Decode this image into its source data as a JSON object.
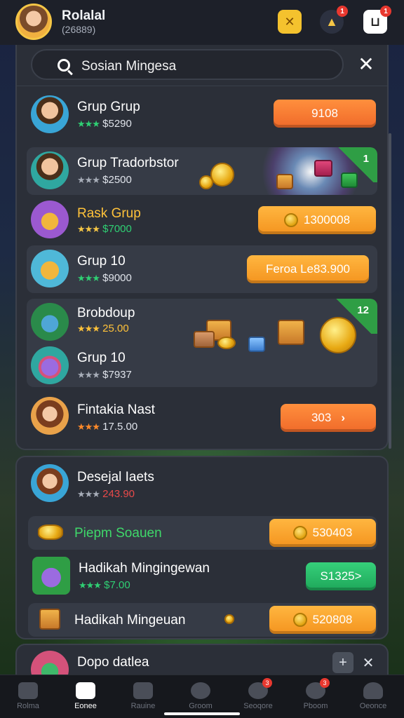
{
  "header": {
    "username": "Rolalal",
    "user_id": "(26889)",
    "badge_gift": "1",
    "badge_mail": "1"
  },
  "search": {
    "value": "Sosian Mingesa"
  },
  "list": [
    {
      "name": "Grup Grup",
      "stars": "★★★",
      "amount": "$5290",
      "button": "9108"
    },
    {
      "name": "Grup Tradorbstor",
      "stars": "★★★",
      "amount": "$2500",
      "tag": "1"
    },
    {
      "name": "Rask Grup",
      "stars": "★★★",
      "amount": "$7000",
      "button": "1300008"
    },
    {
      "name": "Grup 10",
      "stars": "★★★",
      "amount": "$9000",
      "button": "Feroa Le83.900"
    },
    {
      "name": "Brobdoup",
      "stars": "★★★",
      "amount": "25.00",
      "tag": "12"
    },
    {
      "name": "Grup 10",
      "stars": "★★★",
      "amount": "$7937"
    },
    {
      "name": "Fintakia Nast",
      "stars": "★★★",
      "amount": "17.5.00",
      "button": "303"
    }
  ],
  "section2": {
    "title": "Desejal Iaets",
    "stars": "★★★",
    "amount": "243.90",
    "rows": [
      {
        "name": "Piepm Soauen",
        "button": "530403"
      },
      {
        "name": "Hadikah Mingingewan",
        "stars": "★★★",
        "amount": "$7.00",
        "button": "S1325>"
      },
      {
        "name": "Hadikah Mingeuan",
        "button": "520808"
      }
    ]
  },
  "section3": {
    "title": "Dopo datlea"
  },
  "nav": [
    {
      "label": "Rolma"
    },
    {
      "label": "Eonee"
    },
    {
      "label": "Rauine"
    },
    {
      "label": "Groom"
    },
    {
      "label": "Seoqore",
      "badge": "3"
    },
    {
      "label": "Pboom",
      "badge": "3"
    },
    {
      "label": "Oeonce"
    }
  ],
  "colors": {
    "accent_orange": "#f06a2a",
    "accent_amber": "#f4941f",
    "accent_green": "#1ea75a",
    "panel": "#2b2f38"
  }
}
